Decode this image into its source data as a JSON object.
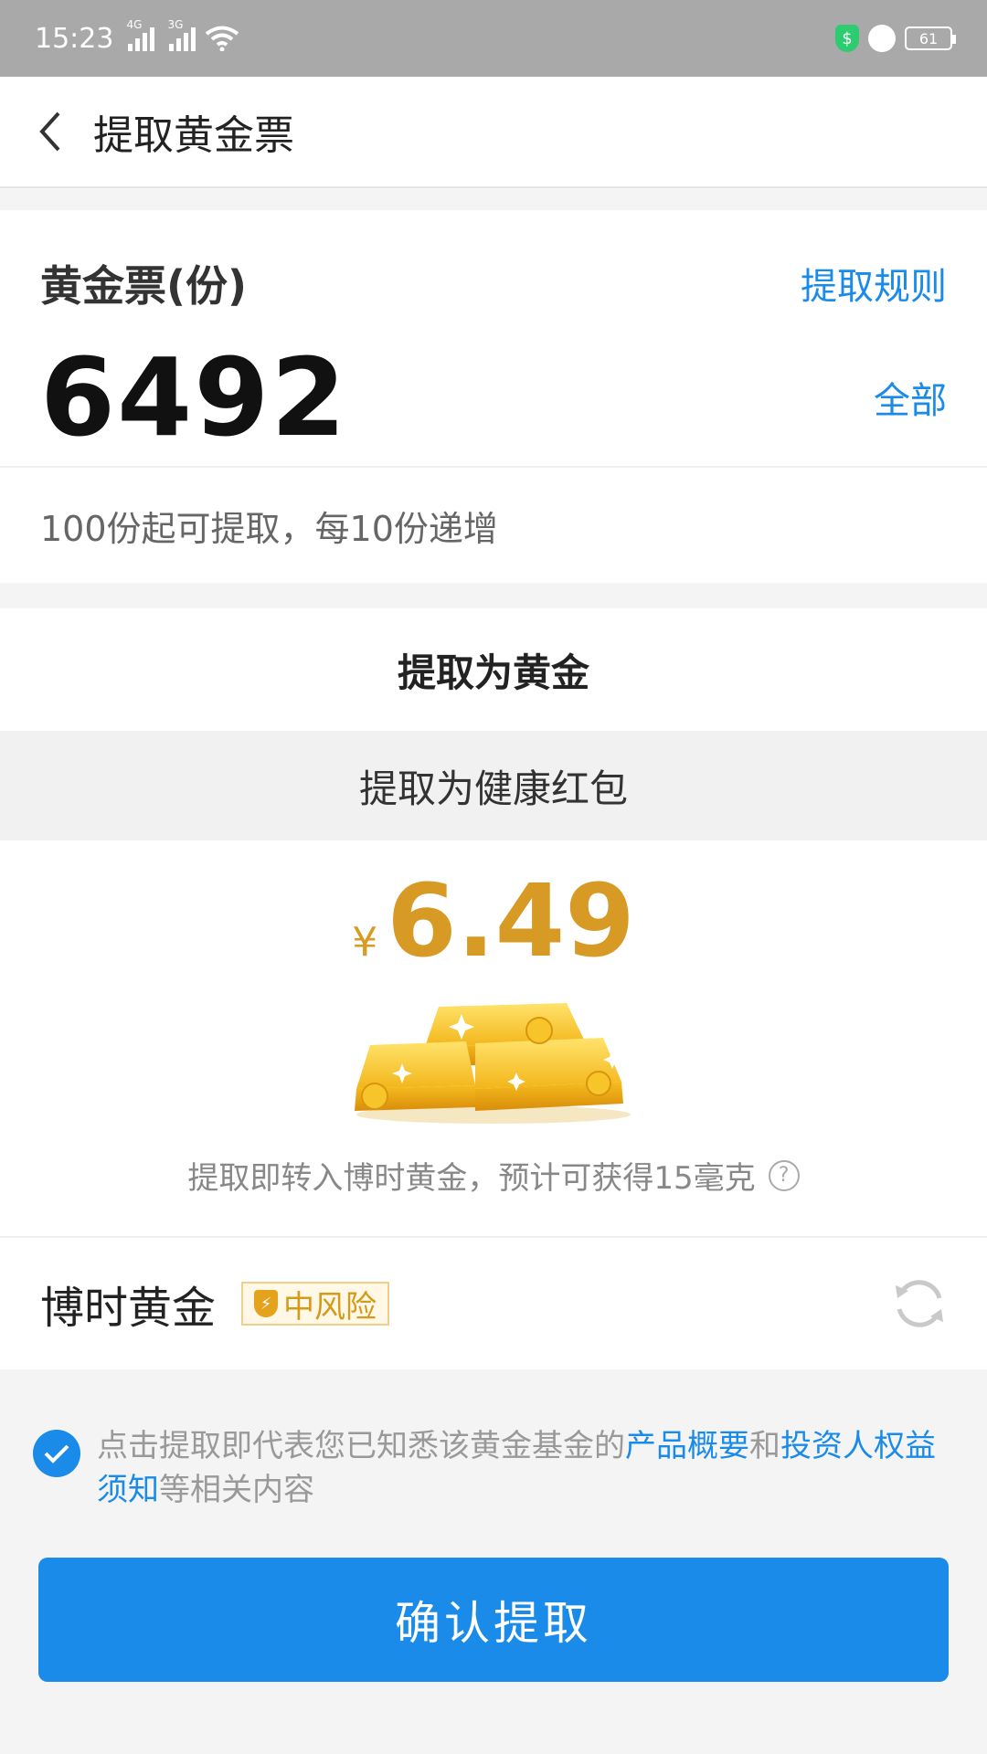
{
  "status_bar": {
    "time": "15:23",
    "net1": "4G",
    "net2": "3G",
    "battery": "61"
  },
  "header": {
    "title": "提取黄金票"
  },
  "balance": {
    "label": "黄金票(份)",
    "rules_link": "提取规则",
    "amount": "6492",
    "all_link": "全部",
    "hint": "100份起可提取，每10份递增"
  },
  "options": {
    "gold": "提取为黄金",
    "red_packet": "提取为健康红包"
  },
  "gold_panel": {
    "currency": "¥",
    "value": "6.49",
    "description": "提取即转入博时黄金，预计可获得15毫克",
    "help_icon": "?"
  },
  "fund": {
    "name": "博时黄金",
    "risk": "中风险",
    "risk_icon_glyph": "⚡"
  },
  "agreement": {
    "prefix": "点击提取即代表您已知悉该黄金基金的",
    "link1": "产品概要",
    "mid": "和",
    "link2": "投资人权益须知",
    "suffix": "等相关内容"
  },
  "confirm_button": "确认提取",
  "colors": {
    "accent": "#1a8be8",
    "gold": "#d69a25"
  }
}
